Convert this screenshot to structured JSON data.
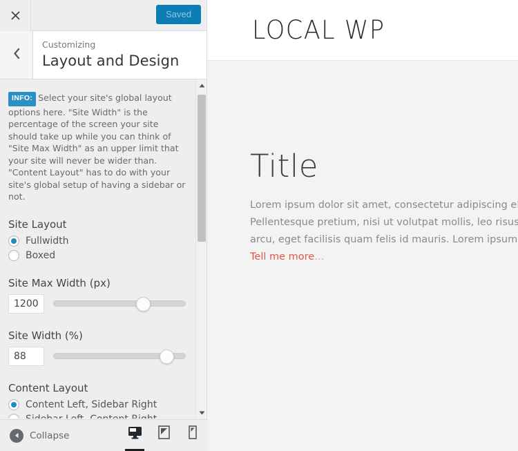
{
  "customizer": {
    "close_icon": "close-icon",
    "save_button": "Saved",
    "back_icon": "chevron-left-icon",
    "eyebrow": "Customizing",
    "title": "Layout and Design",
    "info": {
      "badge": "INFO:",
      "text": "Select your site's global layout options here. \"Site Width\" is the percentage of the screen your site should take up while you can think of \"Site Max Width\" as an upper limit that your site will never be wider than. \"Content Layout\" has to do with your site's global setup of having a sidebar or not."
    },
    "controls": [
      {
        "id": "site-layout",
        "type": "radio",
        "label": "Site Layout",
        "options": [
          {
            "label": "Fullwidth",
            "selected": true
          },
          {
            "label": "Boxed",
            "selected": false
          }
        ]
      },
      {
        "id": "site-max-width",
        "type": "slider",
        "label": "Site Max Width (px)",
        "value": "1200",
        "percent": 70
      },
      {
        "id": "site-width",
        "type": "slider",
        "label": "Site Width (%)",
        "value": "88",
        "percent": 90
      },
      {
        "id": "content-layout",
        "type": "radio",
        "label": "Content Layout",
        "options": [
          {
            "label": "Content Left, Sidebar Right",
            "selected": true
          },
          {
            "label": "Sidebar Left, Content Right",
            "selected": false
          }
        ]
      }
    ],
    "scrollbar": {
      "up_icon": "scroll-up-arrow-icon",
      "down_icon": "scroll-down-arrow-icon"
    },
    "footer": {
      "collapse_label": "Collapse",
      "collapse_icon": "collapse-arrow-icon",
      "devices": [
        {
          "name": "desktop",
          "icon": "desktop-icon",
          "active": true
        },
        {
          "name": "tablet",
          "icon": "tablet-icon",
          "active": false
        },
        {
          "name": "mobile",
          "icon": "mobile-icon",
          "active": false
        }
      ]
    },
    "colors": {
      "accent": "#0d7db5",
      "radio_fill": "#1e8cbe",
      "info_badge": "#2a90c4"
    }
  },
  "preview": {
    "site_title": "LOCAL WP",
    "entry_title": "Title",
    "paragraph_lines": [
      "Lorem ipsum dolor sit amet, consectetur adipiscing elit.",
      "Pellentesque pretium, nisi ut volutpat mollis, leo risus interdum",
      "arcu, eget facilisis quam felis id mauris. Lorem ipsum dolor sit"
    ],
    "more_link": "Tell me more",
    "more_ellipsis": "…",
    "link_color": "#e0564c"
  }
}
